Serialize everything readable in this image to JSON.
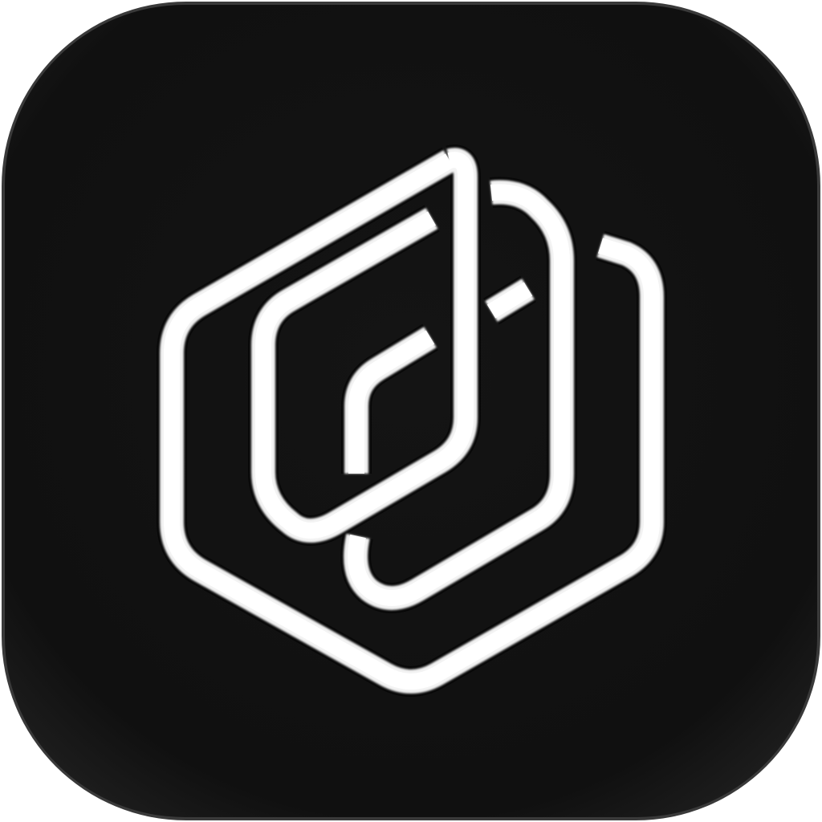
{
  "app_icon": {
    "name": "music-note-hexagon-logo",
    "colors": {
      "tile": "#111111",
      "tile_edge": "#2a2a2a",
      "stroke": "#f4f4f4",
      "stroke_shadow": "#000000"
    }
  }
}
